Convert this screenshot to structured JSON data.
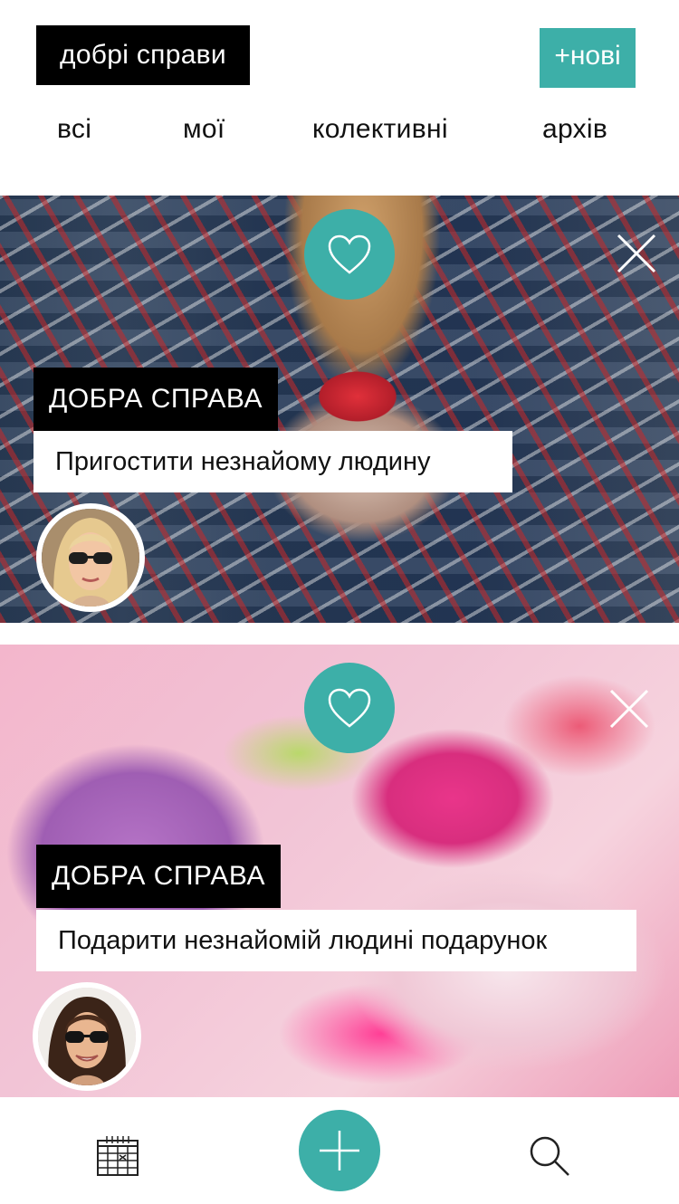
{
  "header": {
    "title": "добрі справи",
    "new_button": "+нові"
  },
  "tabs": [
    {
      "label": "всі"
    },
    {
      "label": "мої"
    },
    {
      "label": "колективні"
    },
    {
      "label": "архів"
    }
  ],
  "cards": [
    {
      "category": "ДОБРА СПРАВА",
      "task": "Пригостити незнайому людину",
      "image_icon": "photo-plaid-scarf-coffee-cup",
      "avatar_icon": "avatar-blonde-sunglasses"
    },
    {
      "category": "ДОБРА СПРАВА",
      "task": "Подарити незнайомій людині подарунок",
      "image_icon": "photo-pink-gift-boxes",
      "avatar_icon": "avatar-brunette-sunglasses"
    }
  ],
  "icons": {
    "like": "heart-icon",
    "close": "close-icon",
    "calendar": "calendar-icon",
    "add": "plus-icon",
    "search": "search-icon"
  },
  "colors": {
    "accent": "#3dafa8",
    "dark": "#000000",
    "background": "#ffffff"
  }
}
